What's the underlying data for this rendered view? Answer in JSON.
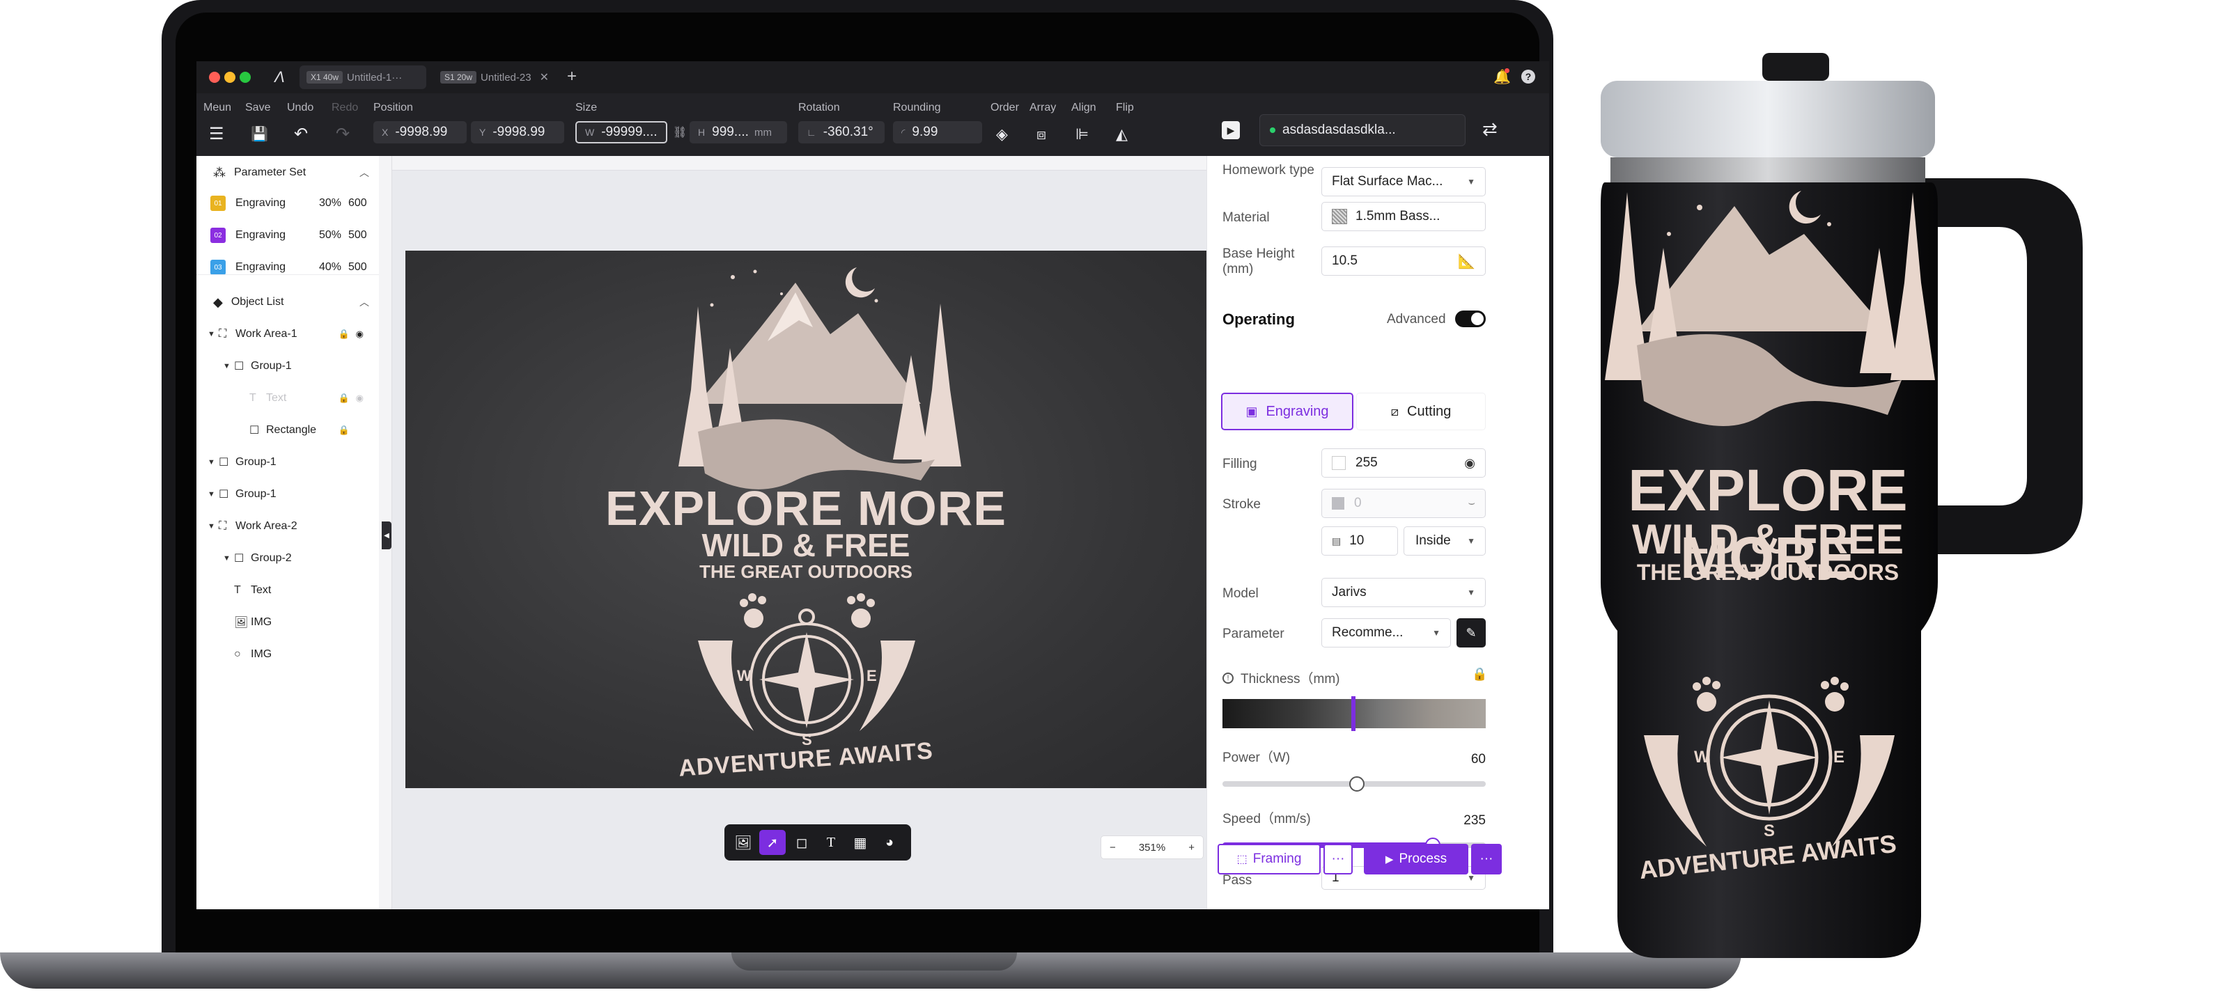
{
  "window": {
    "tabs": [
      {
        "badge": "X1 40w",
        "label": "Untitled-1···"
      },
      {
        "badge": "S1 20w",
        "label": "Untitled-23"
      }
    ]
  },
  "toolbar": {
    "menu_label": "Meun",
    "save_label": "Save",
    "undo_label": "Undo",
    "redo_label": "Redo",
    "position_label": "Position",
    "pos_x_prefix": "X",
    "pos_x": "-9998.99",
    "pos_y_prefix": "Y",
    "pos_y": "-9998.99",
    "size_label": "Size",
    "size_w_prefix": "W",
    "size_w": "-99999....",
    "size_h_prefix": "H",
    "size_h": "999....",
    "size_unit": "mm",
    "rotation_label": "Rotation",
    "rotation": "-360.31°",
    "rounding_label": "Rounding",
    "rounding": "9.99",
    "order_label": "Order",
    "array_label": "Array",
    "align_label": "Align",
    "flip_label": "Flip",
    "device_name": "asdasdasdasdkla...",
    "status_color": "#2bd06c"
  },
  "left_panel": {
    "parameter_set_title": "Parameter Set",
    "parameters": [
      {
        "index": "01",
        "color": "#e9b320",
        "name": "Engraving",
        "power": "30%",
        "speed": "600"
      },
      {
        "index": "02",
        "color": "#8b2ee0",
        "name": "Engraving",
        "power": "50%",
        "speed": "500"
      },
      {
        "index": "03",
        "color": "#3aa0e8",
        "name": "Engraving",
        "power": "40%",
        "speed": "500"
      }
    ],
    "object_list_title": "Object List",
    "tree": [
      {
        "label": "Work Area-1",
        "icon": "work-area-icon",
        "expander": "▼",
        "indent": 0,
        "lock": true,
        "eye": true,
        "dim": false
      },
      {
        "label": "Group-1",
        "icon": "group-icon",
        "expander": "▼",
        "indent": 1,
        "lock": false,
        "eye": false,
        "dim": false
      },
      {
        "label": "Text",
        "icon": "text-icon",
        "expander": "",
        "indent": 2,
        "lock": true,
        "eye": true,
        "dim": true
      },
      {
        "label": "Rectangle",
        "icon": "rectangle-icon",
        "expander": "",
        "indent": 2,
        "lock": true,
        "eye": false,
        "dim": false
      },
      {
        "label": "Group-1",
        "icon": "group-icon",
        "expander": "▼",
        "indent": 0,
        "lock": false,
        "eye": false,
        "dim": false
      },
      {
        "label": "Group-1",
        "icon": "group-icon",
        "expander": "▼",
        "indent": 0,
        "lock": false,
        "eye": false,
        "dim": false
      },
      {
        "label": "Work Area-2",
        "icon": "work-area-icon",
        "expander": "▼",
        "indent": 0,
        "lock": false,
        "eye": false,
        "dim": false
      },
      {
        "label": "Group-2",
        "icon": "group-icon",
        "expander": "▼",
        "indent": 1,
        "lock": false,
        "eye": false,
        "dim": false
      },
      {
        "label": "Text",
        "icon": "text-icon",
        "expander": "",
        "indent": 1,
        "lock": false,
        "eye": false,
        "dim": false
      },
      {
        "label": "IMG",
        "icon": "image-icon",
        "expander": "",
        "indent": 1,
        "lock": false,
        "eye": false,
        "dim": false
      },
      {
        "label": "IMG",
        "icon": "circle-icon",
        "expander": "",
        "indent": 1,
        "lock": false,
        "eye": false,
        "dim": false
      }
    ]
  },
  "canvas": {
    "design": {
      "line1": "EXPLORE MORE",
      "line2": "WILD & FREE",
      "line3": "THE GREAT OUTDOORS",
      "compass_w": "W",
      "compass_e": "E",
      "compass_s": "S",
      "tagline": "ADVENTURE AWAITS"
    },
    "zoom_minus": "−",
    "zoom_value": "351%",
    "zoom_plus": "+"
  },
  "right_panel": {
    "homework_type_label": "Homework type",
    "homework_type_value": "Flat Surface Mac...",
    "material_label": "Material",
    "material_value": "1.5mm Bass...",
    "base_height_label": "Base Height (mm)",
    "base_height_value": "10.5",
    "operating_title": "Operating",
    "advanced_label": "Advanced",
    "advanced_on": true,
    "mode_engraving": "Engraving",
    "mode_cutting": "Cutting",
    "filling_label": "Filling",
    "filling_value": "255",
    "stroke_label": "Stroke",
    "stroke_value": "0",
    "stroke_width": "10",
    "stroke_position": "Inside",
    "model_label": "Model",
    "model_value": "Jarivs",
    "parameter_label": "Parameter",
    "parameter_value": "Recomme...",
    "thickness_label": "Thickness（mm)",
    "power_label": "Power（W)",
    "power_value": "60",
    "power_fraction": 0.51,
    "speed_label": "Speed（mm/s)",
    "speed_value": "235",
    "speed_fraction": 0.8,
    "pass_label": "Pass",
    "pass_value": "1",
    "framing_label": "Framing",
    "process_label": "Process",
    "more_label": "···",
    "accent_color": "#7c2ee0"
  },
  "product": {
    "line1": "EXPLORE MORE",
    "line2": "WILD & FREE",
    "line3": "THE GREAT OUTDOORS",
    "compass_w": "W",
    "compass_e": "E",
    "compass_s": "S",
    "tagline": "ADVENTURE AWAITS"
  }
}
